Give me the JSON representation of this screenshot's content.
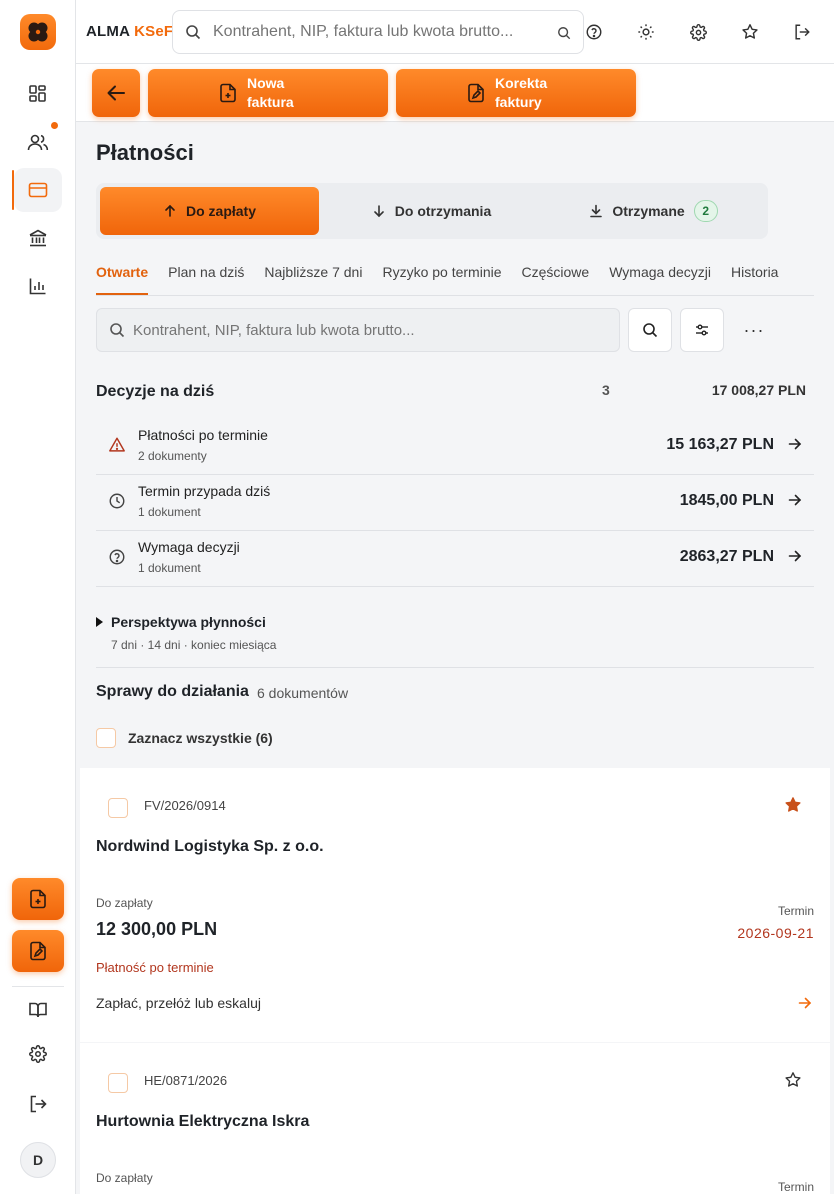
{
  "app": {
    "brand": "ALMA",
    "brand_accent": "KSeF",
    "accent_color": "#f26a0c"
  },
  "header": {
    "search_placeholder": "Kontrahent, NIP, faktura lub kwota brutto...",
    "icons": [
      "help-icon",
      "sun-icon",
      "gear-icon",
      "star-icon",
      "logout-icon"
    ]
  },
  "actions": {
    "new_invoice": "Nowa faktura",
    "correction": "Korekta faktury"
  },
  "sidebar": {
    "avatar": "D"
  },
  "page": {
    "title": "Płatności",
    "segments": [
      {
        "label": "Do zapłaty"
      },
      {
        "label": "Do otrzymania"
      },
      {
        "label": "Otrzymane",
        "badge": "2"
      }
    ],
    "tabs": [
      "Otwarte",
      "Plan na dziś",
      "Najbliższe 7 dni",
      "Ryzyko po terminie",
      "Częściowe",
      "Wymaga decyzji",
      "Historia"
    ],
    "search_placeholder": "Kontrahent, NIP, faktura lub kwota brutto...",
    "more": "···",
    "decisions": {
      "title": "Decyzje na dziś",
      "count": "3",
      "sum": "17 008,27 PLN",
      "rows": [
        {
          "name": "Płatności po terminie",
          "sub": "2 dokumenty",
          "amount": "15 163,27 PLN"
        },
        {
          "name": "Termin przypada dziś",
          "sub": "1 dokument",
          "amount": "1845,00 PLN"
        },
        {
          "name": "Wymaga decyzji",
          "sub": "1 dokument",
          "amount": "2863,27 PLN"
        }
      ]
    },
    "perspective": {
      "title": "Perspektywa płynności",
      "sub": "7 dni · 14 dni · koniec miesiąca"
    },
    "cases": {
      "title": "Sprawy do działania",
      "count": "6 dokumentów",
      "select_all": "Zaznacz wszystkie (6)",
      "items": [
        {
          "number": "FV/2026/0914",
          "starred": true,
          "company": "Nordwind Logistyka Sp. z o.o.",
          "due_label": "Do zapłaty",
          "amount": "12 300,00 PLN",
          "term_label": "Termin",
          "term_date": "2026-09-21",
          "status": "Płatność po terminie",
          "action": "Zapłać, przełóż lub eskaluj"
        },
        {
          "number": "HE/0871/2026",
          "starred": false,
          "company": "Hurtownia Elektryczna Iskra",
          "due_label": "Do zapłaty",
          "term_label": "Termin"
        }
      ]
    }
  }
}
